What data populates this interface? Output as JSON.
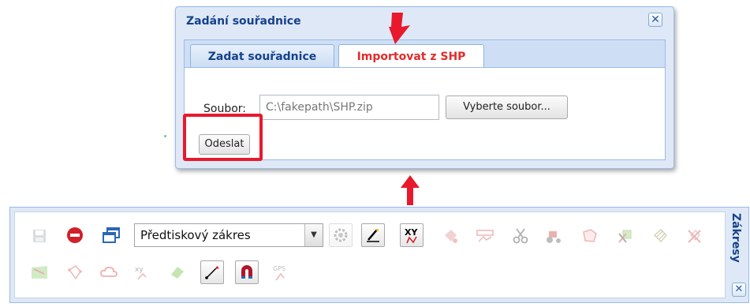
{
  "dialog": {
    "title": "Zadání souřadnice",
    "close_label": "✕",
    "tabs": [
      {
        "label": "Zadat souřadnice",
        "active": false
      },
      {
        "label": "Importovat z SHP",
        "active": true
      }
    ],
    "file_label": "Soubor:",
    "file_value": "C:\\fakepath\\SHP.zip",
    "browse_label": "Vyberte soubor...",
    "submit_label": "Odeslat"
  },
  "toolbar": {
    "panel_title": "Zákresy",
    "close_label": "✕",
    "select_value": "Předtiskový zákres",
    "select_arrow": "▼",
    "row1_icons": [
      "save-icon",
      "stop-icon",
      "windows-icon",
      "gear-icon",
      "pencil-icon",
      "xy-coordinates-icon",
      "fill-icon",
      "measure-icon",
      "scissors-icon",
      "tractor-icon",
      "area-icon",
      "cut-polygon-icon",
      "hatch-icon",
      "cross-hatch-icon"
    ],
    "row2_icons": [
      "map-area-icon",
      "polygon-icon",
      "cloud-icon",
      "xy-point-icon",
      "eraser-icon",
      "draw-line-icon",
      "magnet-icon",
      "gps-icon"
    ],
    "xy_text": "XY",
    "gps_text": "GPS",
    "xy_small_text": "xy"
  },
  "colors": {
    "highlight": "#e8192c",
    "title_blue": "#15428b",
    "active_tab_text": "#e32b2b",
    "panel_bg": "#dfe8f6"
  }
}
